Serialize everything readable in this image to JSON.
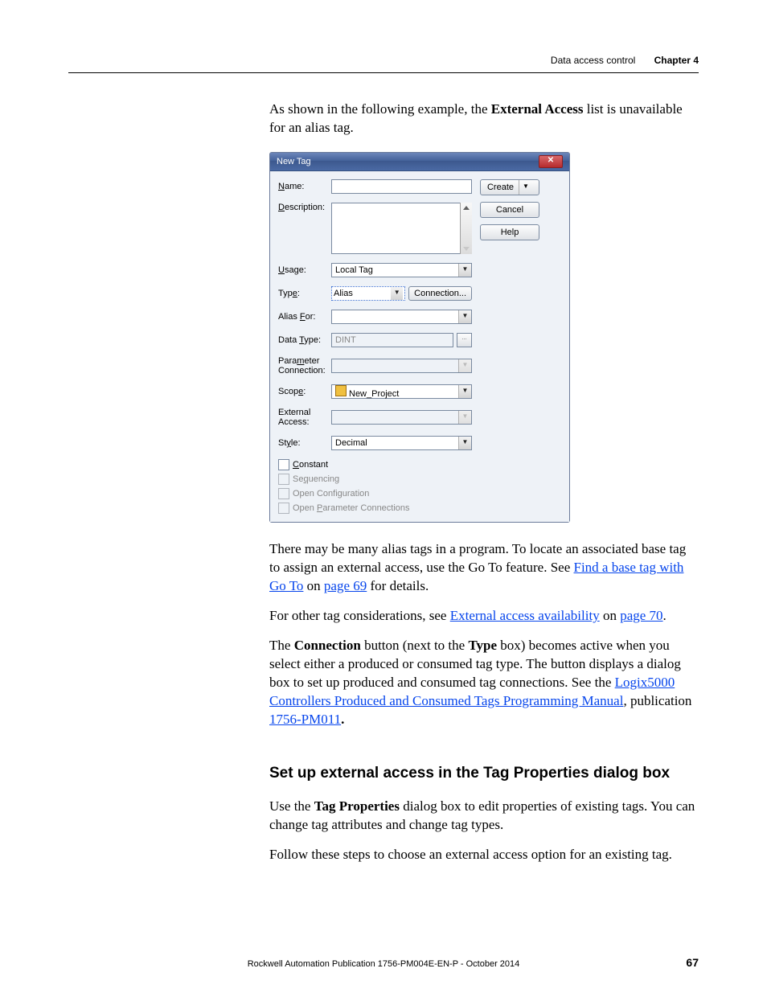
{
  "header": {
    "section": "Data access control",
    "chapter": "Chapter 4"
  },
  "intro_pre": "As shown in the following example, the ",
  "intro_bold": "External Access",
  "intro_post": " list is unavailable for an alias tag.",
  "dialog": {
    "title": "New Tag",
    "close_glyph": "✕",
    "labels": {
      "name_pre": "N",
      "name_post": "ame:",
      "desc_pre": "D",
      "desc_post": "escription:",
      "usage_pre": "U",
      "usage_post": "sage:",
      "type_pre": "Typ",
      "type_ul": "e",
      "type_post": ":",
      "alias_pre": "Alias ",
      "alias_ul": "F",
      "alias_post": "or:",
      "dtype_pre": "Data ",
      "dtype_ul": "T",
      "dtype_post": "ype:",
      "param_pre": "Para",
      "param_ul": "m",
      "param_post": "eter Connection:",
      "scope_pre": "Scop",
      "scope_ul": "e",
      "scope_post": ":",
      "ext": "External Access:",
      "style_pre": "St",
      "style_ul": "y",
      "style_post": "le:"
    },
    "values": {
      "usage": "Local Tag",
      "type": "Alias",
      "dtype": "DINT",
      "scope": "New_Project",
      "style": "Decimal"
    },
    "buttons": {
      "create": "Create",
      "connection_pre": "C",
      "connection_post": "onnection...",
      "cancel": "Cancel",
      "help": "Help",
      "dropdown_glyph": "▼",
      "browse_glyph": "..."
    },
    "checkboxes": {
      "constant_ul": "C",
      "constant_post": "onstant",
      "seq_pre": "Se",
      "seq_ul": "q",
      "seq_post": "uencing",
      "opencfg": "Open Configuration",
      "openparam_pre": "Open ",
      "openparam_ul": "P",
      "openparam_post": "arameter Connections"
    }
  },
  "para2_pre": "There may be many alias tags in a program. To locate an associated base tag to assign an external access,  use  the Go To feature. See ",
  "para2_link1": "Find a base tag with Go To",
  "para2_mid": " on ",
  "para2_link2": "page 69",
  "para2_post": " for details.",
  "para3_pre": "For other tag considerations, see ",
  "para3_link1": "External access availability",
  "para3_mid": " on ",
  "para3_link2": "page 70",
  "para3_post": ".",
  "para4_pre": "The ",
  "para4_b1": "Connection",
  "para4_mid1": " button (next to the ",
  "para4_b2": "Type",
  "para4_mid2": " box) becomes active when you select either a produced or consumed tag type. The button displays a dialog box to set up produced and consumed tag connections. See the ",
  "para4_link1": "Logix5000 Controllers Produced and Consumed Tags Programming Manual",
  "para4_mid3": ", publication ",
  "para4_link2": "1756-PM011",
  "para4_b3": ".",
  "heading": "Set up external access in the Tag Properties dialog box",
  "para5_pre": "Use the ",
  "para5_b1": "Tag Properties",
  "para5_post": " dialog box to edit properties of existing tags. You can change tag attributes and change tag types.",
  "para6": "Follow these steps to choose an external access option for an existing tag.",
  "footer": "Rockwell Automation Publication 1756-PM004E-EN-P - October 2014",
  "page_number": "67"
}
